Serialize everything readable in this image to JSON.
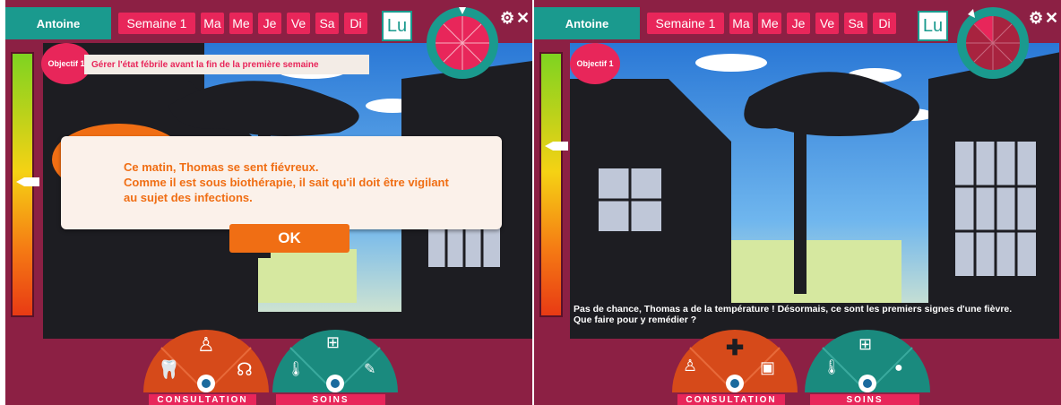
{
  "left": {
    "player": "Antoine",
    "week": "Semaine 1",
    "days": [
      "Ma",
      "Me",
      "Je",
      "Ve",
      "Sa",
      "Di"
    ],
    "active_day": "Lu",
    "objective_label": "Objectif 1",
    "objective_text": "Gérer l'état fébrile avant la fin de la première semaine",
    "dialog_line1": "Ce matin, Thomas se sent fiévreux.",
    "dialog_line2": "Comme il est sous biothérapie, il sait qu'il doit être vigilant",
    "dialog_line3": "au sujet des infections.",
    "ok_label": "OK",
    "menu1_label": "CONSULTATION",
    "menu2_label": "SOINS"
  },
  "right": {
    "player": "Antoine",
    "week": "Semaine 1",
    "days": [
      "Ma",
      "Me",
      "Je",
      "Ve",
      "Sa",
      "Di"
    ],
    "active_day": "Lu",
    "objective_label": "Objectif 1",
    "caption_line1": "Pas de chance, Thomas a de la température ! Désormais, ce sont les premiers signes d'une fièvre.",
    "caption_line2": "Que faire pour y remédier ?",
    "menu1_label": "CONSULTATION",
    "menu2_label": "SOINS"
  },
  "colors": {
    "brand_teal": "#1a9a8e",
    "brand_pink": "#e8265a",
    "frame_maroon": "#8c2044",
    "accent_orange": "#f06e14"
  },
  "icons": [
    "settings-icon",
    "close-icon",
    "tooth-icon",
    "knee-icon",
    "stethoscope-icon",
    "thermometer-icon",
    "first-aid-kit-icon",
    "syringe-icon",
    "cross-icon",
    "pills-icon",
    "medicine-box-icon"
  ]
}
